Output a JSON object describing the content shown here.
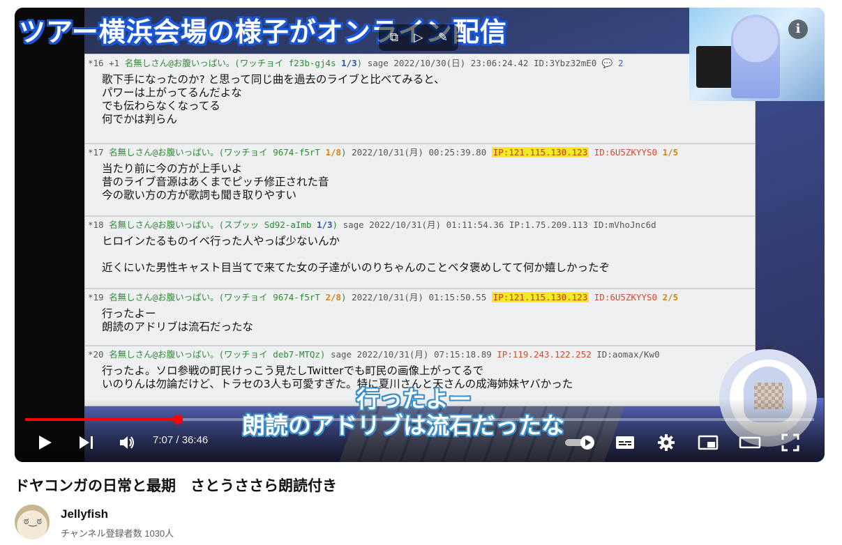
{
  "video": {
    "banner_text": "ツアー横浜会場の様子がオンライン配信",
    "subtitle_line1": "行ったよー",
    "subtitle_line2": "朗読のアドリブは流石だったな",
    "info_icon": "i",
    "posts": [
      {
        "num": "*16",
        "extra": "+1",
        "name": "名無しさん@お腹いっぱい。",
        "id_tag": "(ワッチョイ f23b-gj4s",
        "count": "1/3",
        "close": ")",
        "sage": "sage",
        "date": "2022/10/30(日) 23:06:24.42",
        "ip": "",
        "id": "ID:3Ybz32mE0",
        "id_count": "",
        "replies": "2",
        "lines": [
          "歌下手になったのか? と思って同じ曲を過去のライブと比べてみると、",
          "パワーは上がってるんだよな",
          "でも伝わらなくなってる",
          "何でかは判らん"
        ]
      },
      {
        "num": "*17",
        "extra": "",
        "name": "名無しさん@お腹いっぱい。",
        "id_tag": "(ワッチョイ 9674-f5rT",
        "count": "1/8",
        "close": ")",
        "sage": "",
        "date": "2022/10/31(月) 00:25:39.80",
        "ip": "IP:121.115.130.123",
        "id": "ID:6U5ZKYYS0",
        "id_count": "1/5",
        "replies": "",
        "lines": [
          "当たり前に今の方が上手いよ",
          "昔のライブ音源はあくまでピッチ修正された音",
          "今の歌い方の方が歌詞も聞き取りやすい"
        ]
      },
      {
        "num": "*18",
        "extra": "",
        "name": "名無しさん@お腹いっぱい。",
        "id_tag": "(スプッッ Sd92-aImb",
        "count": "1/3",
        "close": ")",
        "sage": "sage",
        "date": "2022/10/31(月) 01:11:54.36",
        "ip": "IP:1.75.209.113",
        "id": "ID:mVhoJnc6d",
        "id_count": "",
        "replies": "",
        "lines": [
          "ヒロインたるものイベ行った人やっぱ少ないんか",
          "",
          "近くにいた男性キャスト目当てで来てた女の子達がいのりちゃんのことベタ褒めしてて何か嬉しかったぞ"
        ]
      },
      {
        "num": "*19",
        "extra": "",
        "name": "名無しさん@お腹いっぱい。",
        "id_tag": "(ワッチョイ 9674-f5rT",
        "count": "2/8",
        "close": ")",
        "sage": "",
        "date": "2022/10/31(月) 01:15:50.55",
        "ip": "IP:121.115.130.123",
        "id": "ID:6U5ZKYYS0",
        "id_count": "2/5",
        "replies": "",
        "lines": [
          "行ったよー",
          "朗読のアドリブは流石だったな"
        ]
      },
      {
        "num": "*20",
        "extra": "",
        "name": "名無しさん@お腹いっぱい。",
        "id_tag": "(ワッチョイ deb7-MTQz)",
        "count": "",
        "close": "",
        "sage": "sage",
        "date": "2022/10/31(月) 07:15:18.89",
        "ip": "IP:119.243.122.252",
        "id": "ID:aomax/Kw0",
        "id_count": "",
        "replies": "",
        "lines": [
          "行ったよ。ソロ参戦の町民けっこう見たしTwitterでも町民の画像上がってるで",
          "いのりんは勿論だけど、トラセの3人も可愛すぎた。特に夏川さんと天さんの成海姉妹ヤバかった"
        ]
      }
    ],
    "player": {
      "current_time": "7:07",
      "separator": " / ",
      "duration": "36:46",
      "progress": 0.194
    }
  },
  "meta": {
    "title": "ドヤコンガの日常と最期　さとうささら朗読付き",
    "channel_name": "Jellyfish",
    "subscribers": "チャンネル登録者数 1030人",
    "accent_color": "#ff0000"
  }
}
